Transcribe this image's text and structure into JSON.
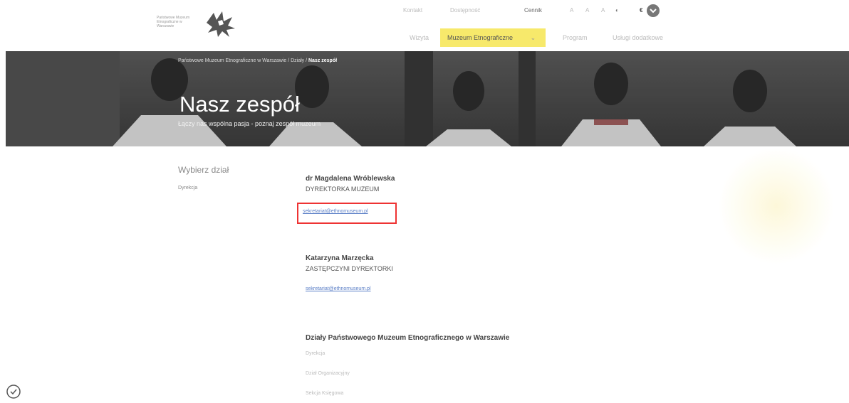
{
  "header": {
    "logo_text": "Państwowe Muzeum Etnograficzne w Warszawie",
    "topbar": [
      "Kontakt",
      "Dostępność",
      "Cennik",
      "A",
      "A",
      "A"
    ],
    "lang": "€",
    "nav": [
      {
        "label": "Wizyta"
      },
      {
        "label": "Muzeum Etnograficzne",
        "active": true
      },
      {
        "label": "Program"
      },
      {
        "label": "Usługi dodatkowe"
      }
    ]
  },
  "hero": {
    "breadcrumb_prefix": "Państwowe Muzeum Etnograficzne w Warszawie / Działy / ",
    "breadcrumb_current": "Nasz zespół",
    "title": "Nasz zespół",
    "subtitle": "Łączy nas wspólna pasja - poznaj zespół muzeum"
  },
  "sidebar": {
    "title": "Wybierz dział",
    "items": [
      "Dyrekcja"
    ]
  },
  "people": [
    {
      "name": "dr Magdalena Wróblewska",
      "role": "DYREKTORKA MUZEUM",
      "email": "sekretariat@ethnomuseum.pl"
    },
    {
      "name": "Katarzyna Marzęcka",
      "role": "ZASTĘPCZYNI DYREKTORKI",
      "email": "sekretariat@ethnomuseum.pl"
    }
  ],
  "departments": {
    "title": "Działy Państwowego Muzeum Etnograficznego w Warszawie",
    "items": [
      "Dyrekcja",
      "Dział Organizacyjny",
      "Sekcja Księgowa"
    ]
  },
  "colors": {
    "accent": "#f7e96b",
    "highlight_border": "#ee3333",
    "link": "#5a7ec6"
  }
}
